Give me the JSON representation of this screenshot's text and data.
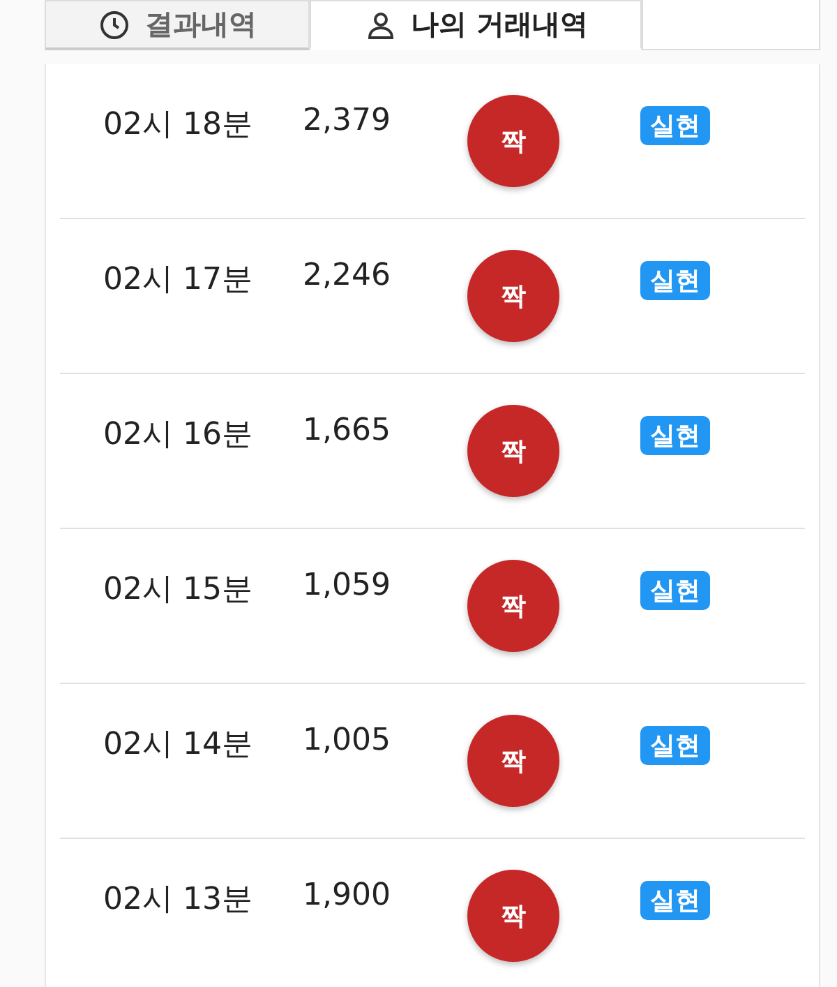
{
  "tabs": [
    {
      "label": "결과내역",
      "selected": false
    },
    {
      "label": "나의 거래내역",
      "selected": true
    }
  ],
  "rows": [
    {
      "time": "02시 18분",
      "value": "2,379",
      "result": "짝",
      "status": "실현"
    },
    {
      "time": "02시 17분",
      "value": "2,246",
      "result": "짝",
      "status": "실현"
    },
    {
      "time": "02시 16분",
      "value": "1,665",
      "result": "짝",
      "status": "실현"
    },
    {
      "time": "02시 15분",
      "value": "1,059",
      "result": "짝",
      "status": "실현"
    },
    {
      "time": "02시 14분",
      "value": "1,005",
      "result": "짝",
      "status": "실현"
    },
    {
      "time": "02시 13분",
      "value": "1,900",
      "result": "짝",
      "status": "실현"
    }
  ]
}
